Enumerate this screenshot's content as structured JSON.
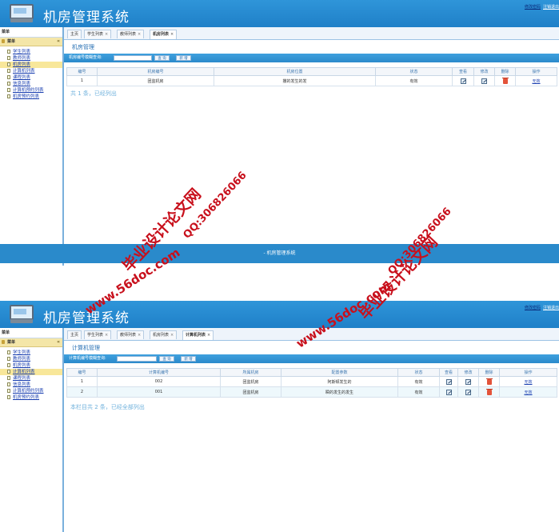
{
  "screens": [
    {
      "app_title": "机房管理系统",
      "top_links": [
        "修改密码",
        "注销退出"
      ],
      "sidebar_top": "菜单",
      "menu_header": "菜单",
      "menu_items": [
        "学生列表",
        "教师列表",
        "机房列表",
        "计算机列表",
        "课程列表",
        "信息列表",
        "计算机预约列表",
        "机房预约列表"
      ],
      "active_menu_index": 2,
      "tabs": [
        {
          "label": "主页",
          "closable": false
        },
        {
          "label": "学生列表",
          "closable": true
        },
        {
          "label": "教师列表",
          "closable": true
        },
        {
          "label": "机房列表",
          "closable": true
        }
      ],
      "active_tab_index": 3,
      "panel_title": "机房管理",
      "search_label": "机房编号模糊查询:",
      "search_value": "",
      "search_button": "查 询",
      "add_button": "新 增",
      "columns": [
        "编号",
        "机房编号",
        "机房位置",
        "状态",
        "查看",
        "修改",
        "删除",
        "操作"
      ],
      "rows": [
        {
          "id": "1",
          "code": "团监机房",
          "location": "撒的发生的发",
          "status": "有效",
          "action": "无效"
        }
      ],
      "footer": "共 1 条，已经列出"
    },
    {
      "app_title": "机房管理系统",
      "top_links": [
        "修改密码",
        "注销退出"
      ],
      "sidebar_top": "菜单",
      "menu_header": "菜单",
      "menu_items": [
        "学生列表",
        "教师列表",
        "机房列表",
        "计算机列表",
        "课程列表",
        "信息列表",
        "计算机预约列表",
        "机房预约列表"
      ],
      "active_menu_index": 3,
      "tabs": [
        {
          "label": "主页",
          "closable": false
        },
        {
          "label": "学生列表",
          "closable": true
        },
        {
          "label": "教师列表",
          "closable": true
        },
        {
          "label": "机房列表",
          "closable": true
        },
        {
          "label": "计算机列表",
          "closable": true
        }
      ],
      "active_tab_index": 4,
      "panel_title": "计算机管理",
      "search_label": "计算机编号模糊查询:",
      "search_value": "",
      "search_button": "查 询",
      "add_button": "新 增",
      "columns": [
        "编号",
        "计算机编号",
        "所属机房",
        "配置参数",
        "状态",
        "查看",
        "修改",
        "删除",
        "操作"
      ],
      "rows": [
        {
          "id": "1",
          "code": "002",
          "room": "团监机房",
          "config": "阿斯顿发生的",
          "status": "有效",
          "action": "无效"
        },
        {
          "id": "2",
          "code": "001",
          "room": "团监机房",
          "config": "瞬的发生的发生",
          "status": "有效",
          "action": "无效"
        }
      ],
      "footer": "本栏目共 2 条，已经全部列出"
    }
  ],
  "bottom_bar": "- 机房管理系统",
  "watermarks": [
    "毕业设计论文网",
    "QQ:306826066",
    "www.56doc.com"
  ],
  "colors": {
    "header": "#1f80c8",
    "accent": "#2a8acb",
    "menu_active": "#f8e79a",
    "watermark": "#c8101c"
  }
}
